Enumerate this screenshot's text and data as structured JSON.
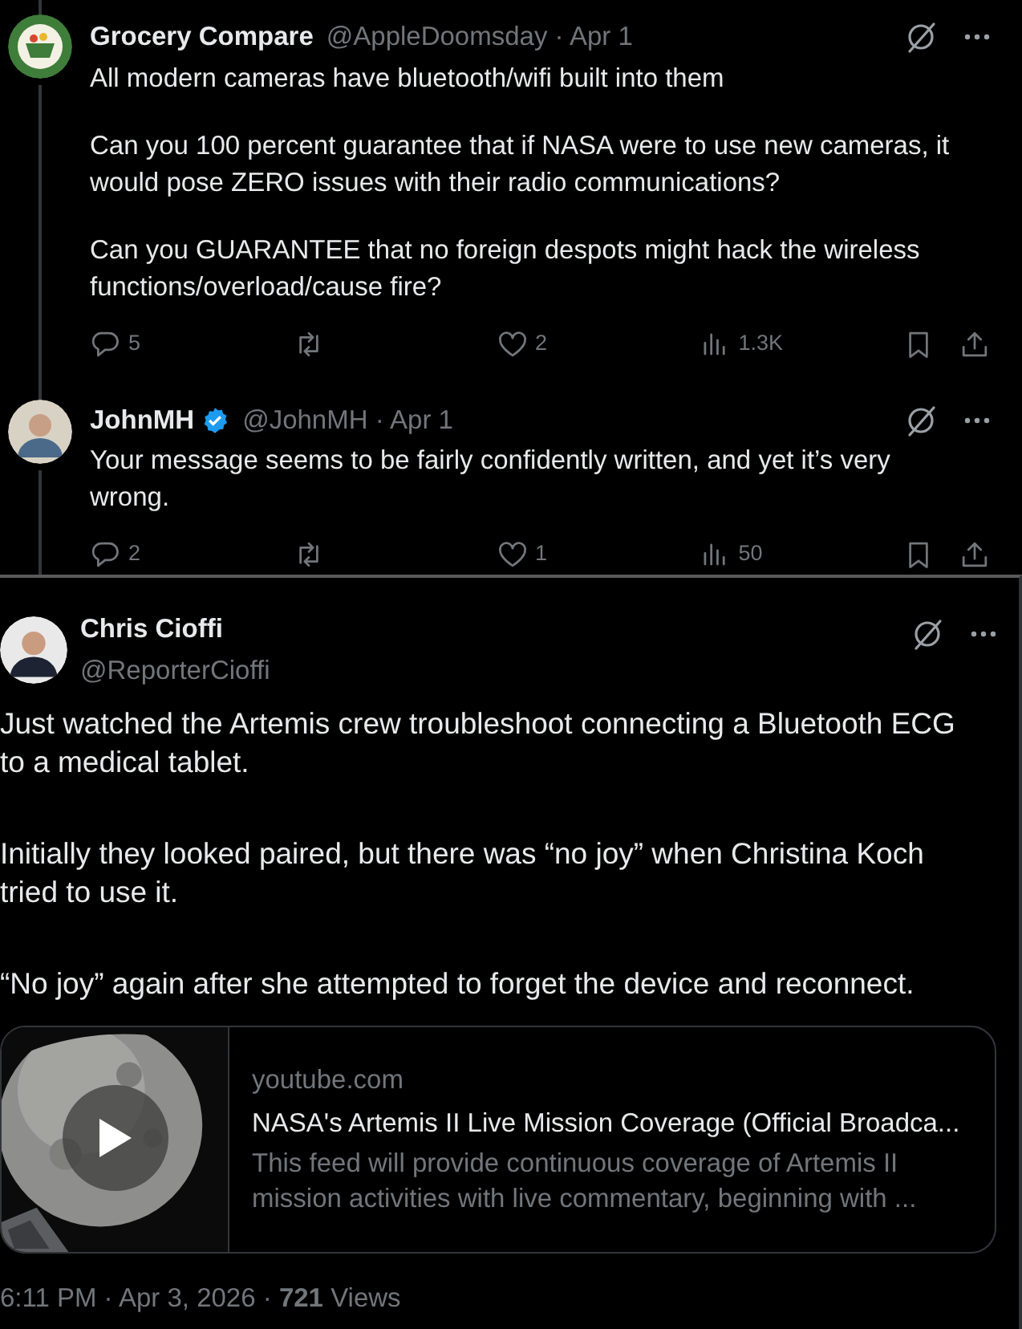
{
  "replies": [
    {
      "name": "Grocery Compare",
      "verified": false,
      "meta": "@AppleDoomsday · Apr 1",
      "paragraphs": [
        "All modern cameras have bluetooth/wifi built into them",
        "Can you 100 percent guarantee that if NASA were to use new cameras, it would pose ZERO issues with their radio communications?",
        "Can you GUARANTEE that no foreign despots might hack the wireless functions/overload/cause fire?"
      ],
      "reply_count": "5",
      "like_count": "2",
      "view_count": "1.3K"
    },
    {
      "name": "JohnMH",
      "verified": true,
      "meta": "@JohnMH · Apr 1",
      "paragraphs": [
        "Your message seems to be fairly confidently written, and yet it’s very wrong."
      ],
      "reply_count": "2",
      "like_count": "1",
      "view_count": "50"
    }
  ],
  "main_tweet": {
    "name": "Chris Cioffi",
    "handle": "@ReporterCioffi",
    "paragraphs": [
      "Just watched the Artemis crew troubleshoot connecting a Bluetooth ECG to a medical tablet.",
      "Initially they looked paired, but there was “no joy” when Christina Koch tried to use it.",
      "“No joy” again after she attempted to forget the device and reconnect."
    ],
    "card": {
      "kind": "picture",
      "domain": "youtube.com",
      "title": "NASA's Artemis II Live Mission Coverage (Official Broadca...",
      "description": "This feed will provide continuous coverage of Artemis II mission activities with live commentary, beginning with ..."
    },
    "footer": "6:11 PM · Apr 3, 2026 · **721** Views"
  }
}
